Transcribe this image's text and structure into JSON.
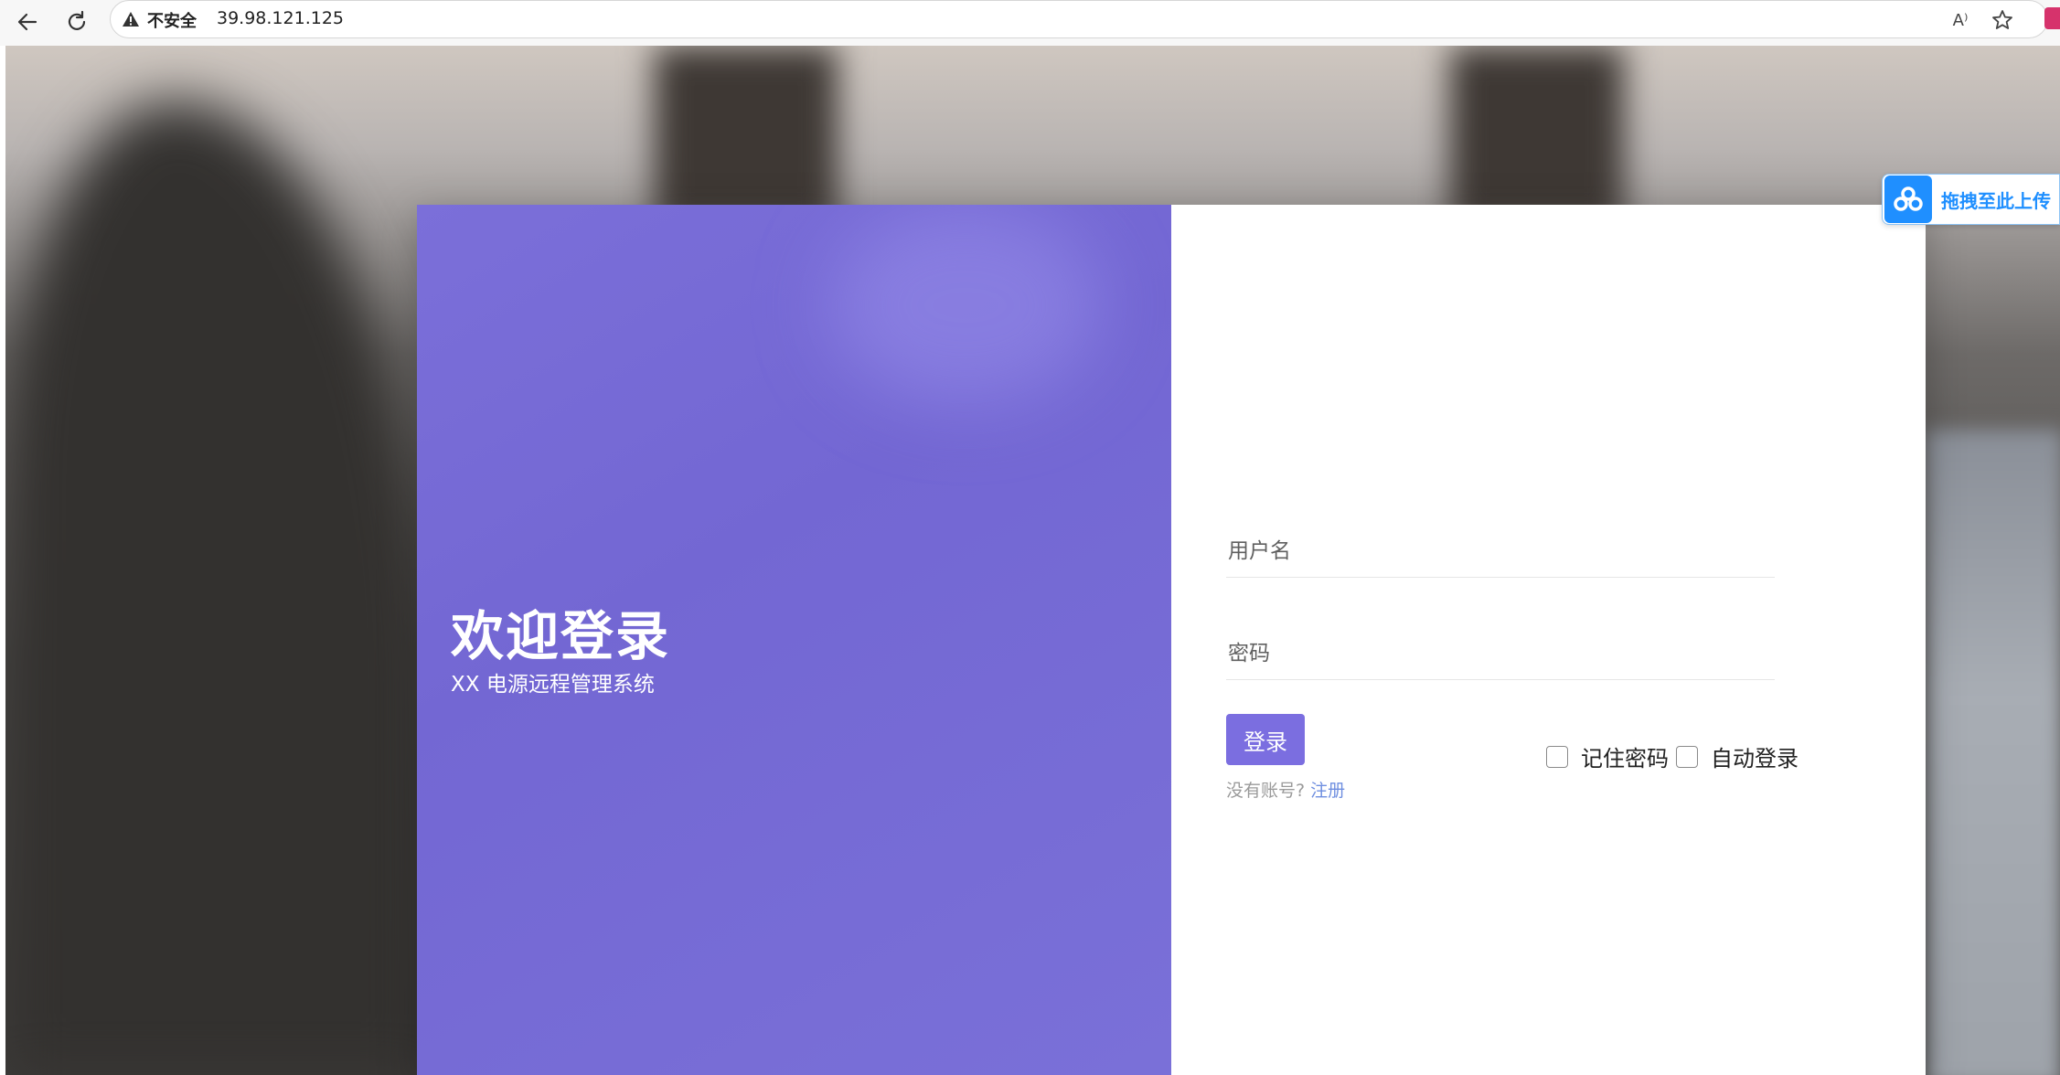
{
  "browser": {
    "security_label": "不安全",
    "url": "39.98.121.125",
    "read_aloud_label": "A⁾"
  },
  "login": {
    "welcome_title": "欢迎登录",
    "welcome_subtitle": "XX 电源远程管理系统",
    "username_placeholder": "用户名",
    "password_placeholder": "密码",
    "login_button": "登录",
    "no_account_text": "没有账号?",
    "register_link": "注册",
    "remember_password": "记住密码",
    "auto_login": "自动登录"
  },
  "upload_widget": {
    "label": "拖拽至此上传"
  },
  "colors": {
    "accent_purple": "#7b6ee0",
    "link_blue": "#6f8fe0",
    "upload_blue": "#1f8fff"
  }
}
